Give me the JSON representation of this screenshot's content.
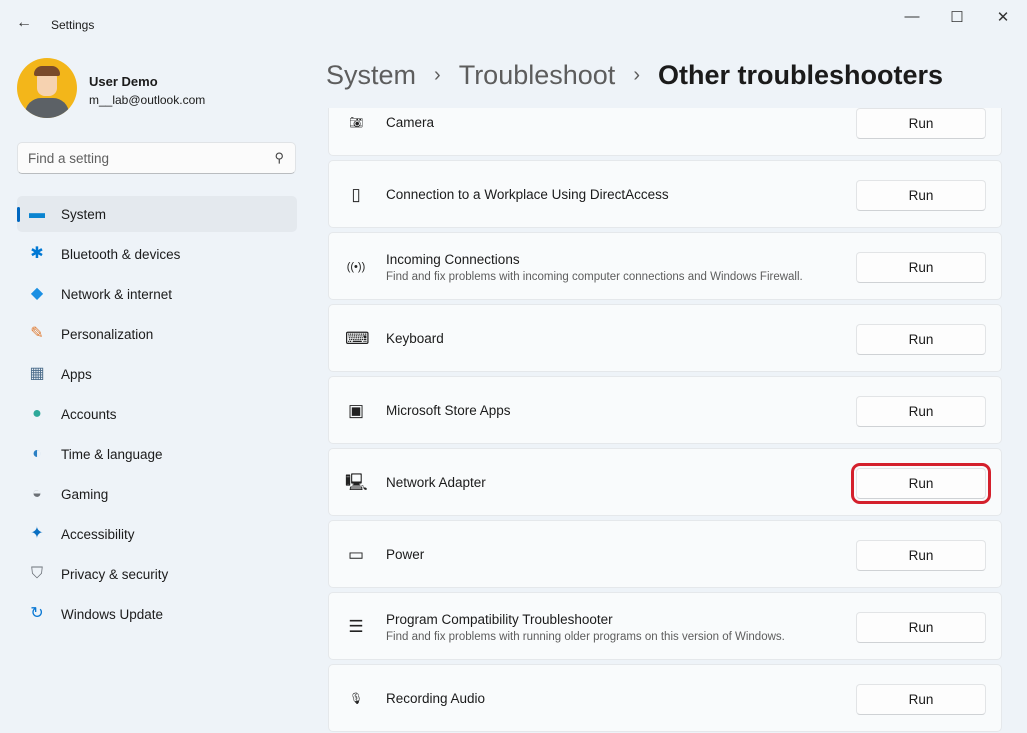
{
  "app": {
    "title": "Settings",
    "back": "←",
    "minimize": "—",
    "maximize": "☐",
    "close": "✕"
  },
  "user": {
    "name": "User Demo",
    "email": "m__lab@outlook.com"
  },
  "search": {
    "placeholder": "Find a setting"
  },
  "sidebar": {
    "items": [
      {
        "label": "System",
        "icon": "▬",
        "color": "#0a84d0",
        "active": true
      },
      {
        "label": "Bluetooth & devices",
        "icon": "✱",
        "color": "#0078d4"
      },
      {
        "label": "Network & internet",
        "icon": "◆",
        "color": "#1a8fe3"
      },
      {
        "label": "Personalization",
        "icon": "✎",
        "color": "#e07a30"
      },
      {
        "label": "Apps",
        "icon": "▦",
        "color": "#4a6b8a"
      },
      {
        "label": "Accounts",
        "icon": "●",
        "color": "#2ea89a"
      },
      {
        "label": "Time & language",
        "icon": "◐",
        "color": "#2a7fc4"
      },
      {
        "label": "Gaming",
        "icon": "◒",
        "color": "#6b6f75"
      },
      {
        "label": "Accessibility",
        "icon": "✦",
        "color": "#0a6fc2"
      },
      {
        "label": "Privacy & security",
        "icon": "⛉",
        "color": "#6b7078"
      },
      {
        "label": "Windows Update",
        "icon": "↻",
        "color": "#0a78d4"
      }
    ]
  },
  "breadcrumb": {
    "items": [
      "System",
      "Troubleshoot",
      "Other troubleshooters"
    ],
    "sep": "›"
  },
  "troubleshooters": [
    {
      "title": "Camera",
      "icon": "📷︎",
      "button": "Run"
    },
    {
      "title": "Connection to a Workplace Using DirectAccess",
      "icon": "▯",
      "button": "Run"
    },
    {
      "title": "Incoming Connections",
      "desc": "Find and fix problems with incoming computer connections and Windows Firewall.",
      "icon": "((•))",
      "button": "Run"
    },
    {
      "title": "Keyboard",
      "icon": "⌨",
      "button": "Run"
    },
    {
      "title": "Microsoft Store Apps",
      "icon": "▣",
      "button": "Run"
    },
    {
      "title": "Network Adapter",
      "icon": "🖳",
      "button": "Run",
      "highlighted": true
    },
    {
      "title": "Power",
      "icon": "▭",
      "button": "Run"
    },
    {
      "title": "Program Compatibility Troubleshooter",
      "desc": "Find and fix problems with running older programs on this version of Windows.",
      "icon": "☰",
      "button": "Run"
    },
    {
      "title": "Recording Audio",
      "icon": "🎙︎",
      "button": "Run"
    }
  ],
  "colors": {
    "accent": "#0067c0",
    "highlight": "#d4202c"
  }
}
